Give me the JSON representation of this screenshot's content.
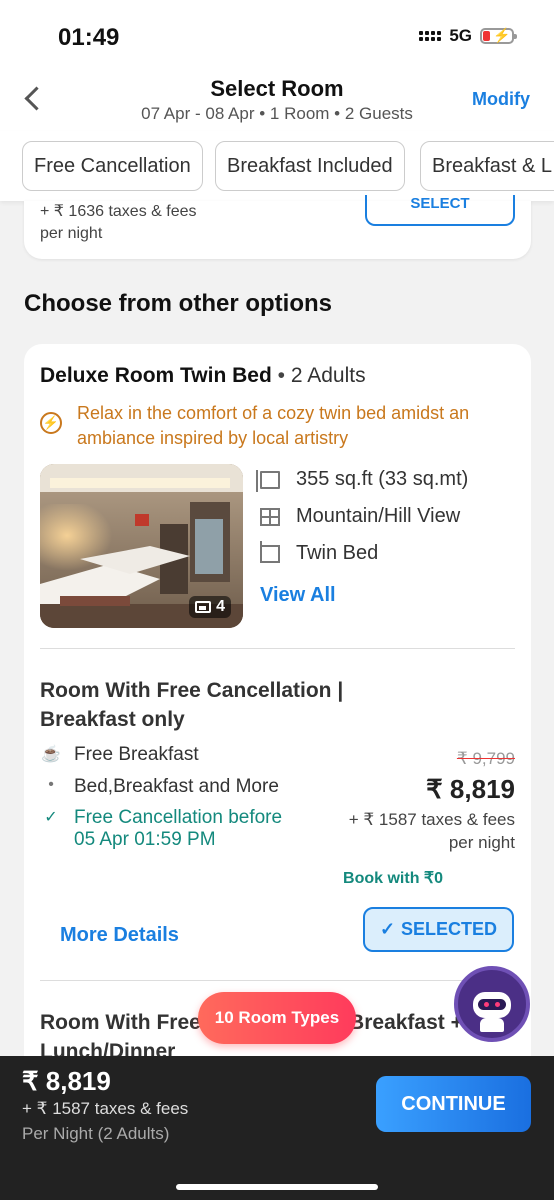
{
  "status": {
    "time": "01:49",
    "network": "5G"
  },
  "header": {
    "title": "Select Room",
    "subtitle": "07 Apr - 08 Apr • 1 Room • 2 Guests",
    "modify": "Modify"
  },
  "filters": [
    "Free Cancellation",
    "Breakfast Included",
    "Breakfast & L"
  ],
  "previous_plan": {
    "tax": "+ ₹ 1636 taxes & fees",
    "per_night": "per night",
    "select": "SELECT"
  },
  "section_title": "Choose from other options",
  "room": {
    "name": "Deluxe Room Twin Bed",
    "dot": " • ",
    "occupancy": "2 Adults",
    "promo": "Relax in the comfort of a cozy twin bed amidst an ambiance inspired by local artistry",
    "photo_count": "4",
    "features": [
      "355 sq.ft (33 sq.mt)",
      "Mountain/Hill View",
      "Twin Bed"
    ],
    "view_all": "View All",
    "icons": [
      "area-icon",
      "window-view-icon",
      "bed-icon"
    ]
  },
  "plan": {
    "title": "Room With Free Cancellation | Breakfast only",
    "inclusions": {
      "breakfast": "Free Breakfast",
      "more": "Bed,Breakfast and More",
      "cancel_label": "Free Cancellation",
      "cancel_before": " before",
      "cancel_date": "05 Apr 01:59 PM"
    },
    "original_price": "₹ 9,799",
    "price": "₹ 8,819",
    "tax": "+ ₹ 1587 taxes & fees",
    "per_night": "per night",
    "book_with": "Book with ₹0",
    "more_details": "More Details",
    "selected": "SELECTED"
  },
  "next_plan": {
    "title": "Room With Free Cancellation | Breakfast + Lunch/Dinner"
  },
  "room_types_pill": "10 Room Types",
  "bottom_bar": {
    "price": "₹ 8,819",
    "tax": "+ ₹ 1587 taxes & fees",
    "per_night": "Per Night (2 Adults)",
    "continue": "CONTINUE"
  },
  "colors": {
    "accent": "#1a7fe0",
    "promo": "#c9781d",
    "success": "#14897d",
    "pill": "#ff4b5c"
  }
}
